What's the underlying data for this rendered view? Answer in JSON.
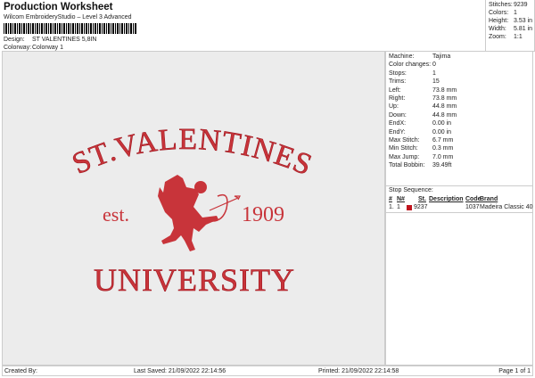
{
  "header": {
    "title": "Production Worksheet",
    "subtitle": "Wilcom EmbroideryStudio – Level 3 Advanced",
    "design_label": "Design:",
    "design": "ST VALENTINES 5,8IN",
    "colorway_label": "Colorway:",
    "colorway": "Colorway 1"
  },
  "stats": [
    [
      "Stitches:",
      "9239"
    ],
    [
      "Colors:",
      "1"
    ],
    [
      "Height:",
      "3.53 in"
    ],
    [
      "Width:",
      "5.81 in"
    ],
    [
      "Zoom:",
      "1:1"
    ]
  ],
  "details": [
    [
      "Machine:",
      "Tajima"
    ],
    [
      "Color changes:",
      "0"
    ],
    [
      "Stops:",
      "1"
    ],
    [
      "Trims:",
      "15"
    ],
    [
      "Left:",
      "73.8 mm"
    ],
    [
      "Right:",
      "73.8 mm"
    ],
    [
      "Up:",
      "44.8 mm"
    ],
    [
      "Down:",
      "44.8 mm"
    ],
    [
      "EndX:",
      "0.00 in"
    ],
    [
      "EndY:",
      "0.00 in"
    ],
    [
      "Max Stitch:",
      "6.7 mm"
    ],
    [
      "Min Stitch:",
      "0.3 mm"
    ],
    [
      "Max Jump:",
      "7.0 mm"
    ],
    [
      "Total Bobbin:",
      "39.49ft"
    ]
  ],
  "stop_sequence": {
    "title": "Stop Sequence:",
    "columns": [
      "#",
      "N#",
      "St.",
      "Description",
      "Code",
      "Brand"
    ],
    "rows": [
      {
        "num": "1.",
        "n": "1",
        "color": "#c0141e",
        "st": "9237",
        "description": "",
        "code": "1037",
        "brand": "Madeira Classic 40"
      }
    ]
  },
  "design_art": {
    "line1": "ST.VALENTINES",
    "est": "est.",
    "year": "1909",
    "line3": "UNIVERSITY",
    "color": "#c8343a"
  },
  "footer": {
    "created_by": "Created By:",
    "last_saved": "Last Saved: 21/09/2022 22:14:56",
    "printed": "Printed: 21/09/2022 22:14:58",
    "page": "Page 1 of 1"
  }
}
